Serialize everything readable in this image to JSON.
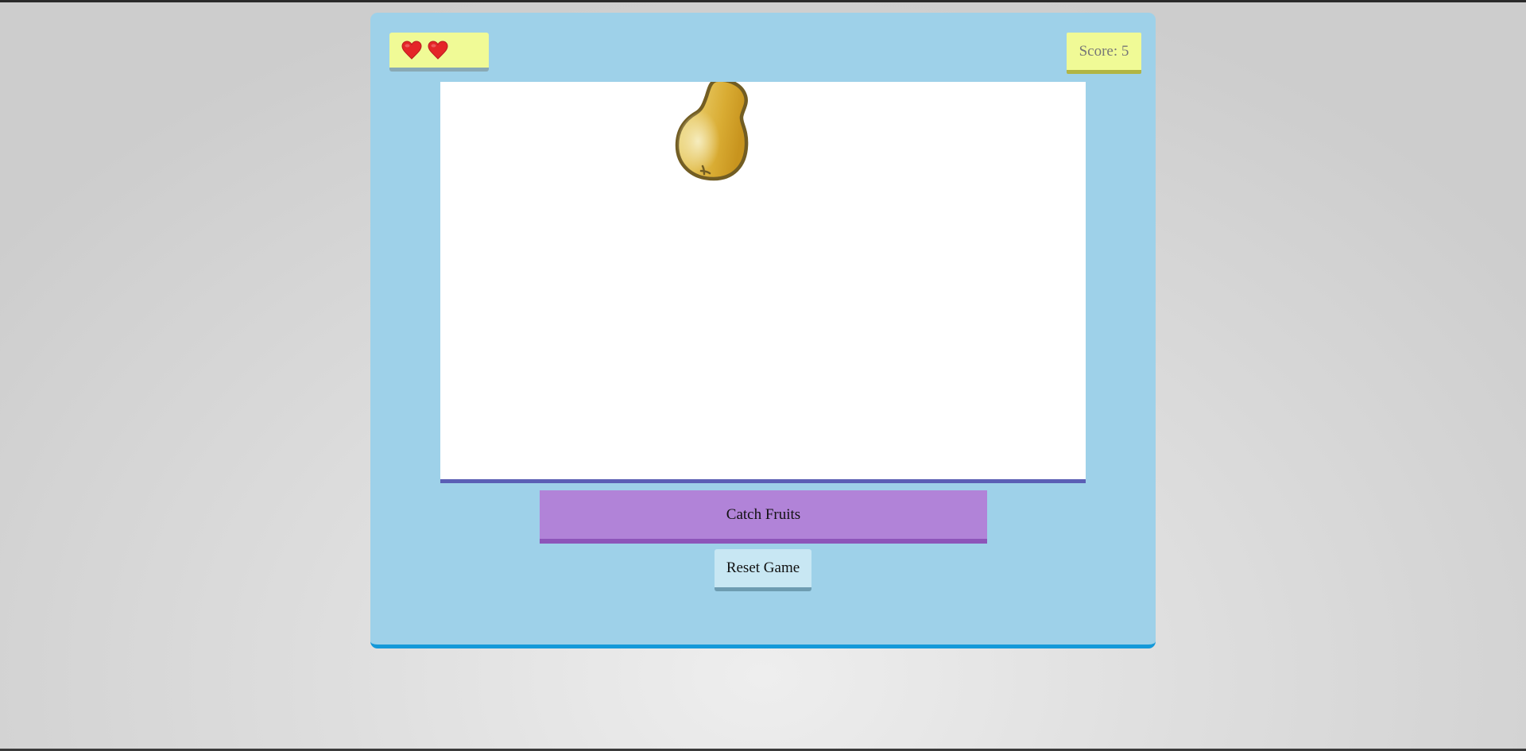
{
  "game": {
    "lives": 2,
    "hearts": [
      "heart-icon",
      "heart-icon"
    ],
    "score_text": "Score: 5",
    "score_value": 5,
    "falling_fruit": "pear-icon",
    "catch_button_label": "Catch Fruits",
    "reset_button_label": "Reset Game"
  },
  "colors": {
    "panel": "#9ed1e9",
    "panel_border": "#1499d9",
    "hud_box": "#f0fa96",
    "heart": "#e42528",
    "play_area": "#ffffff",
    "play_area_border": "#5b5fb5",
    "catch_button": "#b183d8",
    "catch_button_border": "#8d55b9",
    "reset_button": "#c8e7f3",
    "pear": "#d8ad35"
  }
}
